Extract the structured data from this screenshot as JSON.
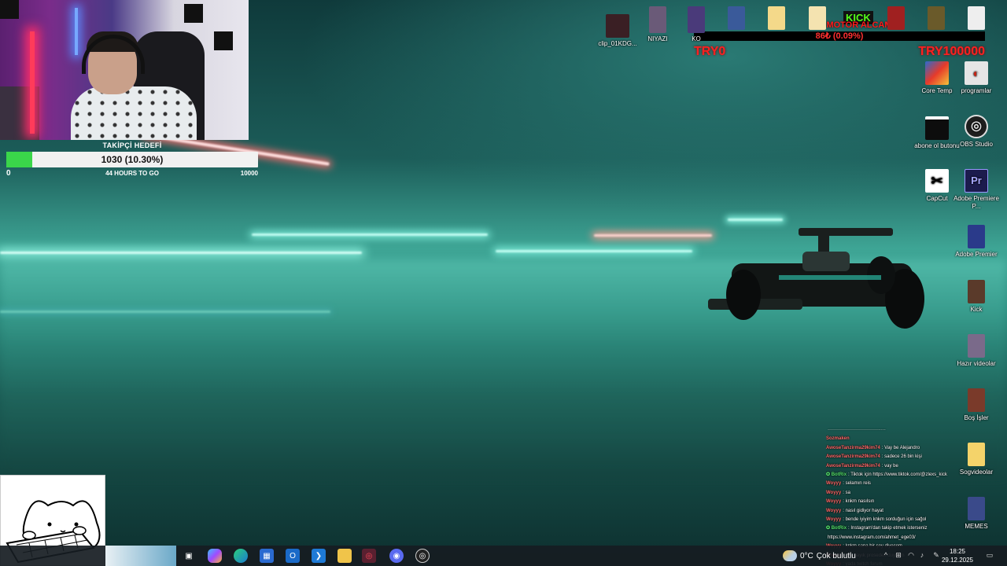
{
  "webcam": {
    "goal": {
      "title": "TAKİPÇİ HEDEFİ",
      "progress_text": "1030 (10.30%)",
      "progress_fraction": 0.103,
      "min": "0",
      "time_left": "44 HOURS TO GO",
      "max": "10000"
    }
  },
  "kick_widget": {
    "logo": "KICK",
    "title": "MOTOR ALCAM",
    "progress_text": "86₺ (0.09%)",
    "min": "TRY0",
    "max": "TRY100000"
  },
  "desktop_icons_top": [
    {
      "label": "clip_01KDG...",
      "icon": "video-thumb-icon"
    },
    {
      "label": "NIYAZI",
      "icon": "video-thumb-icon"
    },
    {
      "label": "KO",
      "icon": "video-thumb-icon"
    }
  ],
  "desktop_icons_right": [
    {
      "label": "Core Temp",
      "icon": "core-temp-icon"
    },
    {
      "label": "programlar",
      "icon": "folder-icon"
    },
    {
      "label": "abone ol butonu",
      "icon": "video-file-icon"
    },
    {
      "label": "OBS Studio",
      "icon": "obs-icon"
    },
    {
      "label": "CapCut",
      "icon": "capcut-icon"
    },
    {
      "label": "Adobe Premiere P...",
      "icon": "premiere-icon"
    },
    {
      "label": "Adobe Premier",
      "icon": "premiere-file-icon"
    },
    {
      "label": "Kick",
      "icon": "file-icon"
    },
    {
      "label": "Hazır videolar",
      "icon": "folder-icon"
    },
    {
      "label": "Boş İşler",
      "icon": "folder-icon"
    },
    {
      "label": "Sogvideolar",
      "icon": "folder-icon"
    },
    {
      "label": "MEMES",
      "icon": "folder-icon"
    }
  ],
  "chat": [
    {
      "user": "",
      "text": "·····································",
      "color": "#7fb0ff"
    },
    {
      "user": "Sozmaken",
      "text": "",
      "color": "#ff6a6a"
    },
    {
      "user": "AwoseTanzirma29kim74",
      "text": ": Vay be Alejandro",
      "color": "#ff6a6a"
    },
    {
      "user": "AwoseTanzirma29kim74",
      "text": ": sadece 26 bin kişi",
      "color": "#ff6a6a"
    },
    {
      "user": "AwoseTanzirma29kim74",
      "text": ": vay be",
      "color": "#ff6a6a"
    },
    {
      "user": "✪ BotRix",
      "text": ": Tiktok için https://www.tiktok.com/@zlexs_kick",
      "color": "#54e36d"
    },
    {
      "user": "Woyyy",
      "text": ": selamın reis",
      "color": "#ff6a6a"
    },
    {
      "user": "Woyyy",
      "text": ": sa",
      "color": "#ff6a6a"
    },
    {
      "user": "Woyyy",
      "text": ": knkm nasılsın",
      "color": "#ff6a6a"
    },
    {
      "user": "Woyyy",
      "text": ": nasıl gidiyor hayat",
      "color": "#ff6a6a"
    },
    {
      "user": "Woyyy",
      "text": ": bende iyiyim knkm sorduğun için sağol",
      "color": "#ff6a6a"
    },
    {
      "user": "✪ BotRix",
      "text": ": Instagram'dan takip etmek isterseniz",
      "color": "#54e36d"
    },
    {
      "user": "",
      "text": "https://www.instagram.com/ahmet_ege03/",
      "color": "#ffffff"
    },
    {
      "user": "Woyyy",
      "text": ": knkm sana bir şey diyecem",
      "color": "#ff6a6a"
    },
    {
      "user": "Woyyy",
      "text": ": çok bayık proseden duydum",
      "color": "#ff6a6a"
    },
    {
      "user": "Woyyy",
      "text": ": yada twitch forum",
      "color": "#ff6a6a"
    }
  ],
  "taskbar": {
    "weather_temp": "0°C",
    "weather_desc": "Çok bulutlu",
    "time": "18:25",
    "date": "29.12.2025",
    "apps": [
      "task-view-icon",
      "copilot-icon",
      "edge-icon",
      "store-icon",
      "outlook-icon",
      "vscode-icon",
      "file-explorer-icon",
      "app-red-icon",
      "discord-icon",
      "obs-taskbar-icon"
    ]
  }
}
